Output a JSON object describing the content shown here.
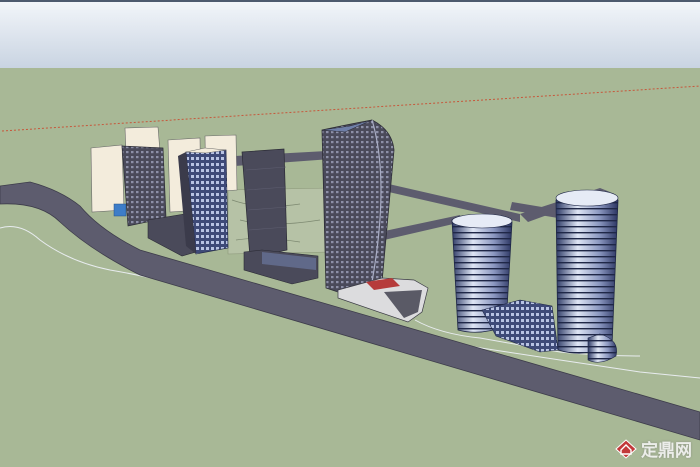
{
  "scene": {
    "sky_top_color": "#f3f6fa",
    "sky_bottom_color": "#c9d4e2",
    "ground_color": "#a8b896",
    "road_color": "#5d5c6e",
    "tower_dark_color": "#4a4a5a",
    "tower_light_color": "#f3ecdc",
    "glass_color": "#6f7fa8"
  },
  "watermark": {
    "text": "定鼎网",
    "logo_icon": "diamond-house-icon"
  }
}
